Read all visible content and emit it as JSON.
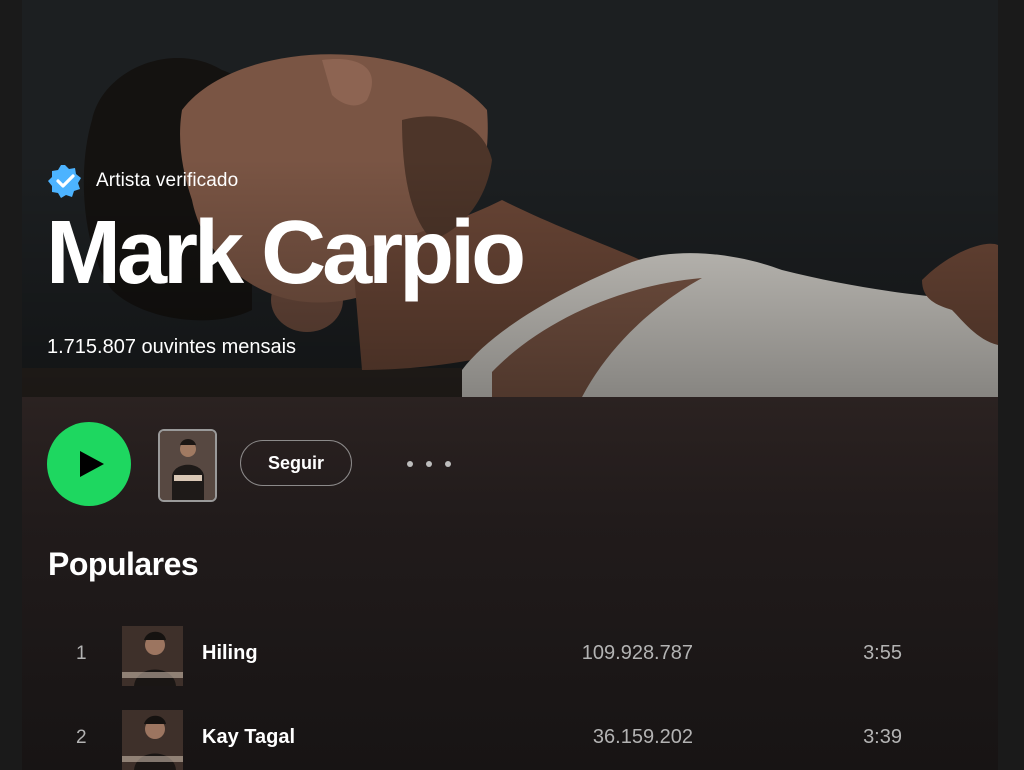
{
  "artist": {
    "verified_label": "Artista verificado",
    "name": "Mark Carpio",
    "monthly_listeners": "1.715.807 ouvintes mensais"
  },
  "actions": {
    "follow_label": "Seguir"
  },
  "popular": {
    "title": "Populares",
    "tracks": [
      {
        "number": "1",
        "title": "Hiling",
        "plays": "109.928.787",
        "duration": "3:55"
      },
      {
        "number": "2",
        "title": "Kay Tagal",
        "plays": "36.159.202",
        "duration": "3:39"
      }
    ]
  },
  "colors": {
    "accent": "#1ed760",
    "verified_badge": "#4cb3ff"
  },
  "icons": [
    "verified-badge-icon",
    "play-icon",
    "more-options-icon"
  ]
}
